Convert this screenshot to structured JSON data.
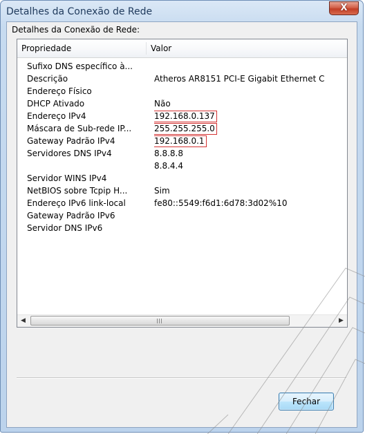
{
  "window": {
    "title": "Detalhes da Conexão de Rede",
    "close_label": "X"
  },
  "section_label": "Detalhes da Conexão de Rede:",
  "list": {
    "columns": [
      "Propriedade",
      "Valor"
    ],
    "rows": [
      {
        "property": "Sufixo DNS específico à...",
        "value": ""
      },
      {
        "property": "Descrição",
        "value": "Atheros AR8151 PCI-E Gigabit Ethernet C"
      },
      {
        "property": "Endereço Físico",
        "value": ""
      },
      {
        "property": "DHCP Ativado",
        "value": "Não"
      },
      {
        "property": "Endereço IPv4",
        "value": "192.168.0.137"
      },
      {
        "property": "Máscara de Sub-rede IP...",
        "value": "255.255.255.0"
      },
      {
        "property": "Gateway Padrão IPv4",
        "value": "192.168.0.1"
      },
      {
        "property": "Servidores DNS IPv4",
        "value": "8.8.8.8"
      },
      {
        "property": "",
        "value": "8.8.4.4"
      },
      {
        "property": "Servidor WINS IPv4",
        "value": ""
      },
      {
        "property": "NetBIOS sobre Tcpip H...",
        "value": "Sim"
      },
      {
        "property": "Endereço IPv6 link-local",
        "value": "fe80::5549:f6d1:6d78:3d02%10"
      },
      {
        "property": "Gateway Padrão IPv6",
        "value": ""
      },
      {
        "property": "Servidor DNS IPv6",
        "value": ""
      }
    ],
    "highlight_color": "#d43131"
  },
  "scrollbar": {
    "left_arrow": "◀",
    "right_arrow": "▶"
  },
  "footer": {
    "close_button": "Fechar"
  }
}
